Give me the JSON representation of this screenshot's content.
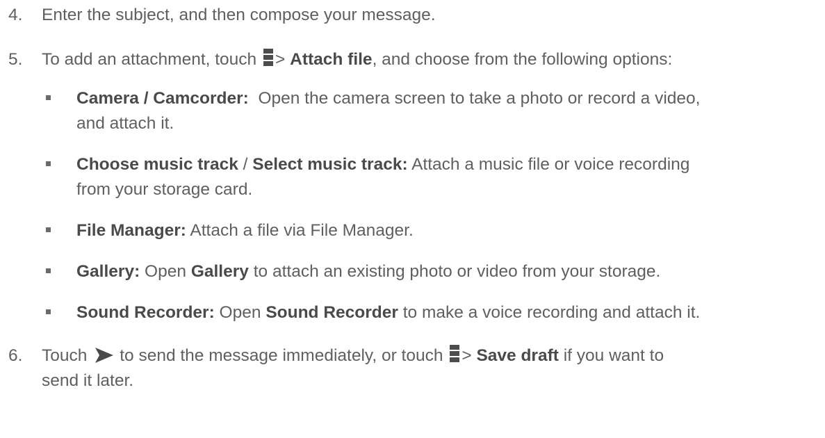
{
  "steps": [
    {
      "number": "4.",
      "text": "Enter the subject, and then compose your message."
    },
    {
      "number": "5.",
      "before": "To add an attachment, touch",
      "sep": ">",
      "action": "Attach file",
      "after": ", and choose from the following options:"
    },
    {
      "number": "6.",
      "touch": "Touch",
      "mid": "to send the message immediately, or touch",
      "sep": ">",
      "action": "Save draft",
      "after_line1": "if you want to",
      "line2": "send it later."
    }
  ],
  "options": [
    {
      "bold": "Camera / Camcorder:",
      "text1": "  Open the camera screen to take a photo or record a video,",
      "text2": "and attach it."
    },
    {
      "bold1": "Choose music track",
      "slash": " / ",
      "bold2": "Select music track:",
      "text1": " Attach a music file or voice recording",
      "text2": "from your storage card."
    },
    {
      "bold": "File Manager:",
      "text": " Attach a file via File Manager."
    },
    {
      "bold": "Gallery:",
      "pre": " Open ",
      "app": "Gallery",
      "post": " to attach an existing photo or video from your storage."
    },
    {
      "bold": "Sound Recorder:",
      "pre": " Open ",
      "app": "Sound Recorder",
      "post": " to make a voice recording and attach it."
    }
  ],
  "icons": {
    "menu": "menu-icon",
    "send": "send-icon",
    "bullet": "bullet-square-icon"
  }
}
